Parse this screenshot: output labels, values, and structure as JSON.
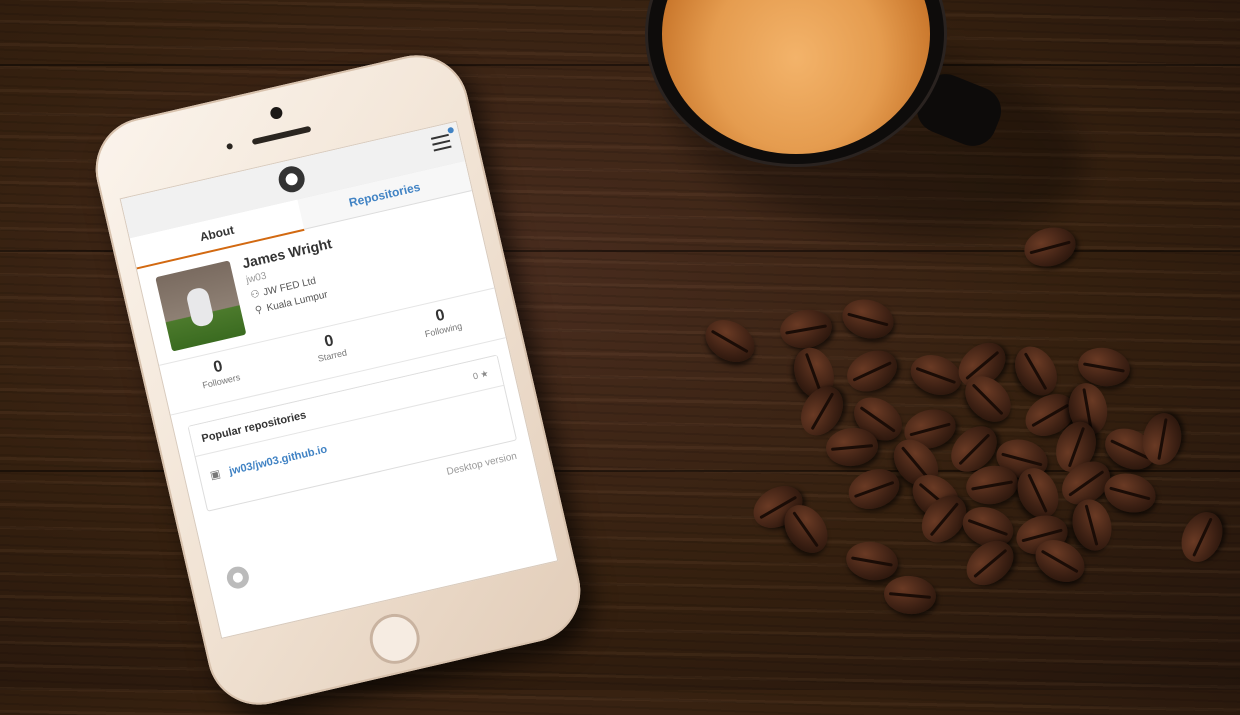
{
  "profile": {
    "name": "James Wright",
    "login": "jw03",
    "company": "JW FED Ltd",
    "location": "Kuala Lumpur"
  },
  "tabs": {
    "about": "About",
    "repositories": "Repositories"
  },
  "stats": {
    "followers_count": "0",
    "followers_label": "Followers",
    "starred_count": "0",
    "starred_label": "Starred",
    "following_count": "0",
    "following_label": "Following"
  },
  "popular": {
    "title": "Popular repositories",
    "count": "0",
    "repo": "jw03/jw03.github.io"
  },
  "footer": {
    "desktop_link": "Desktop version"
  },
  "icons": {
    "menu": "hamburger-menu-icon",
    "logo": "github-octocat-icon",
    "company": "organization-icon",
    "location": "location-pin-icon",
    "star": "star-icon",
    "repo": "repository-icon"
  },
  "colors": {
    "accent_tab": "#d26911",
    "link": "#4183c4"
  }
}
